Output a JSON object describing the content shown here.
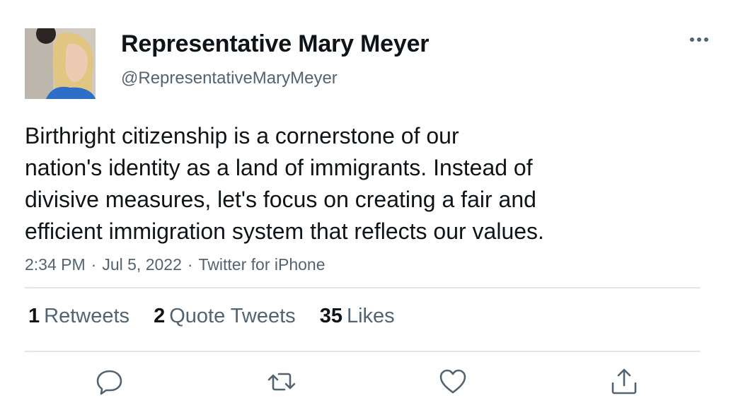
{
  "author": {
    "display_name": "Representative Mary Meyer",
    "handle": "@RepresentativeMaryMeyer"
  },
  "tweet": {
    "lines": [
      "Birthright citizenship is a cornerstone of our",
      "nation's identity as a land of immigrants. Instead of",
      "divisive measures, let's focus on creating a fair and",
      "efficient immigration system that reflects our values."
    ],
    "time": "2:34 PM",
    "date": "Jul 5, 2022",
    "source": "Twitter for iPhone",
    "separator": "·"
  },
  "stats": {
    "retweets": {
      "count": "1",
      "label": "Retweets"
    },
    "quotes": {
      "count": "2",
      "label": "Quote Tweets"
    },
    "likes": {
      "count": "35",
      "label": "Likes"
    }
  },
  "actions": [
    "reply-icon",
    "retweet-icon",
    "like-icon",
    "share-icon"
  ],
  "more_icon": "more-options-icon",
  "colors": {
    "text_primary": "#0f1419",
    "text_secondary": "#536471",
    "divider": "#e1e6ea",
    "icon": "#536471"
  }
}
